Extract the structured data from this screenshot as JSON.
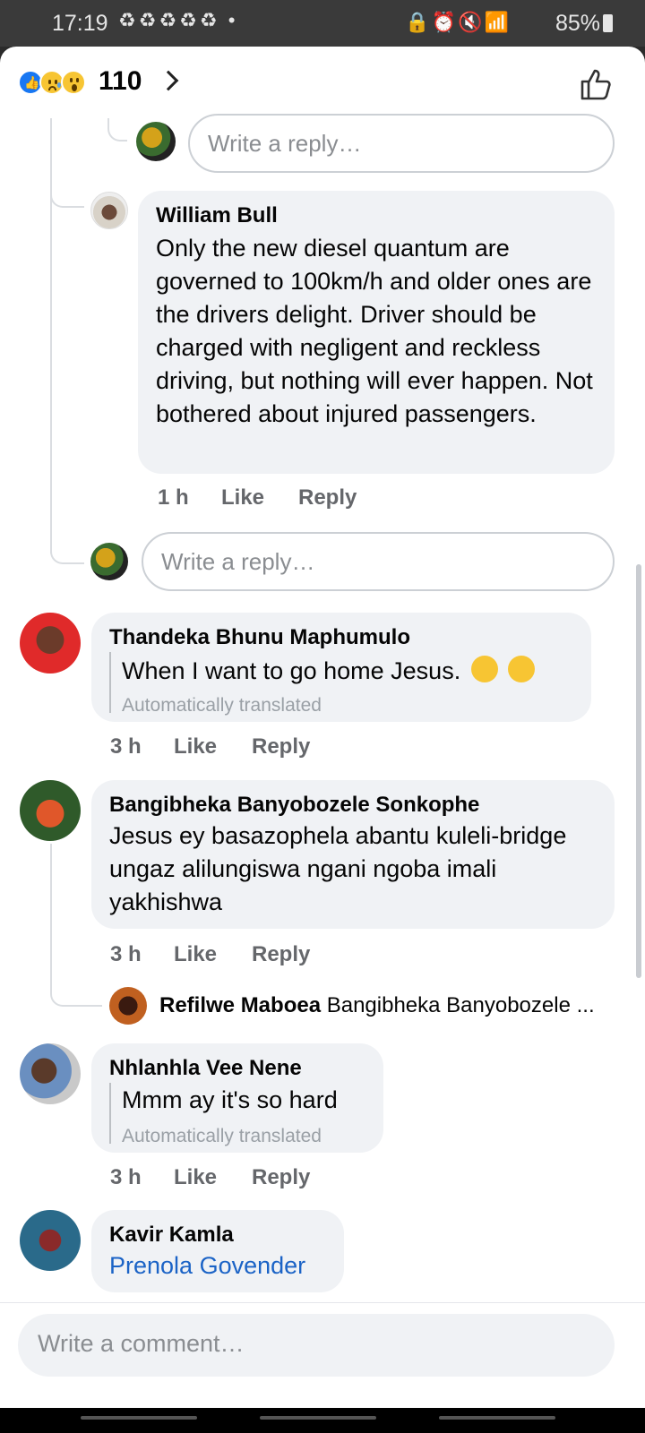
{
  "status_bar": {
    "time": "17:19",
    "notif_icons": "♻♻♻♻♻ •",
    "right_icons": "🔒⏰🔇📶",
    "battery": "85%"
  },
  "header": {
    "reaction_count": "110",
    "reaction_types": [
      "like",
      "sad",
      "wow"
    ]
  },
  "reply_placeholder": "Write a reply…",
  "comments": [
    {
      "author": "William Bull",
      "text": "Only the new diesel quantum are governed to 100km/h and older ones are the drivers delight. Driver should be charged with negligent and reckless driving, but nothing will ever happen. Not bothered about injured passengers.",
      "time": "1 h",
      "like": "Like",
      "reply": "Reply"
    },
    {
      "author": "Thandeka Bhunu Maphumulo",
      "text": "When I want to go home Jesus.",
      "translated_note": "Automatically translated",
      "time": "3 h",
      "like": "Like",
      "reply": "Reply"
    },
    {
      "author": "Bangibheka Banyobozele Sonkophe",
      "text": "Jesus ey basazophela abantu kuleli-bridge ungaz alilungiswa ngani ngoba imali yakhishwa",
      "time": "3 h",
      "like": "Like",
      "reply": "Reply",
      "reply_preview": {
        "author": "Refilwe Maboea",
        "text": "Bangibheka Banyobozele ..."
      }
    },
    {
      "author": "Nhlanhla Vee Nene",
      "text": "Mmm ay it's so hard",
      "translated_note": "Automatically translated",
      "time": "3 h",
      "like": "Like",
      "reply": "Reply"
    },
    {
      "author": "Kavir Kamla",
      "text": "Prenola Govender"
    }
  ],
  "comment_placeholder": "Write a comment…"
}
